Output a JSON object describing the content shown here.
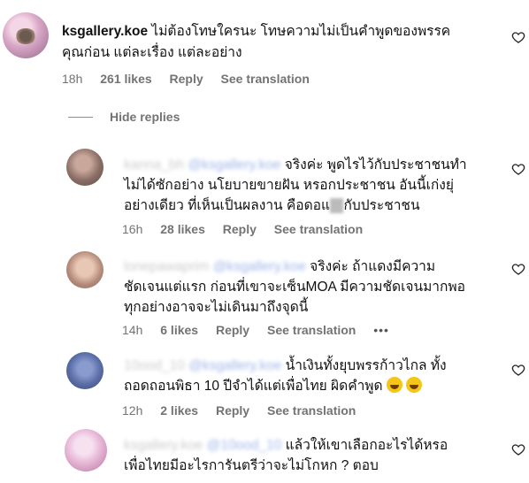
{
  "main_comment": {
    "username": "ksgallery.koe",
    "line1": "ไม่ต้องโทษใครนะ โทษความไม่เป็นคำพูดของพรรค",
    "line2": "คุณก่อน แต่ละเรื่อง แต่ละอย่าง",
    "time": "18h",
    "likes": "261 likes",
    "reply": "Reply",
    "see_translation": "See translation"
  },
  "hide_replies": "Hide replies",
  "replies": [
    {
      "user": "kanna_bh",
      "mention": "@ksgallery.koe",
      "line1": "จริงค่ะ พูดไรไว้กับประชาชนทำ",
      "line2": "ไม่ได้ซักอย่าง นโยบายขายฝัน หรอกประชาชน อันนี้เก่งยุ่",
      "line3": "อย่างเดียว ที่เห็นเป็นผลงาน คือดอแ",
      "line3b": "กับประชาชน",
      "time": "16h",
      "likes": "28 likes",
      "reply": "Reply",
      "see_translation": "See translation"
    },
    {
      "user": "lonepawaprim",
      "mention": "@ksgallery.koe",
      "line1": "จริงค่ะ ถ้าแดงมีความ",
      "line2": "ชัดเจนแต่แรก ก่อนที่เขาจะเซ็นMOA มีความชัดเจนมากพอ",
      "line3": "ทุกอย่างอาจจะไม่เดินมาถึงจุดนี้",
      "time": "14h",
      "likes": "6 likes",
      "reply": "Reply",
      "see_translation": "See translation",
      "more": "•••"
    },
    {
      "user": "10ood_10",
      "mention": "@ksgallery.koe",
      "line1": "น้ำเงินทั้งยุบพรรก้าวไกล ทั้ง",
      "line2": "ถอดถอนพิธา 10 ปีจำได้แต่เพื่อไทย ผิดคำพูด",
      "time": "12h",
      "likes": "2 likes",
      "reply": "Reply",
      "see_translation": "See translation"
    },
    {
      "user": "ksgallery.koe",
      "mention": "@10ood_10",
      "line1": "แล้วให้เขาเลือกอะไรได้หรอ",
      "line2": "เพื่อไทยมีอะไรการันตรีว่าจะไม่โกหก ? ตอบ"
    }
  ]
}
